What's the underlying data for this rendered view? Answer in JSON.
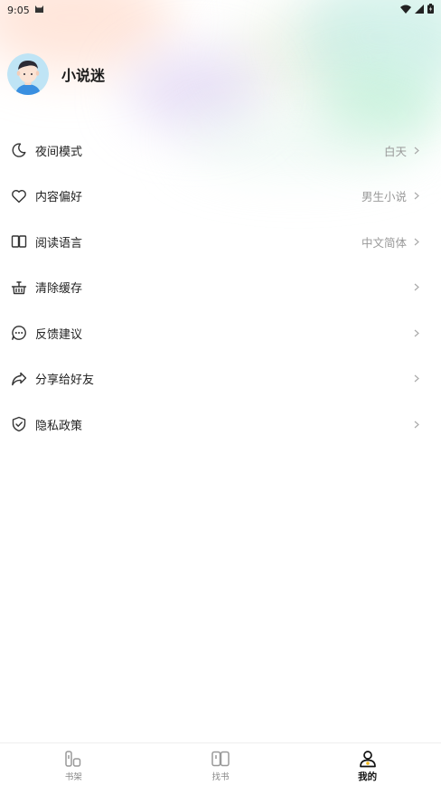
{
  "status_bar": {
    "time": "9:05"
  },
  "profile": {
    "username": "小说迷"
  },
  "menu": {
    "items": [
      {
        "label": "夜间模式",
        "value": "白天",
        "icon": "moon-icon"
      },
      {
        "label": "内容偏好",
        "value": "男生小说",
        "icon": "heart-icon"
      },
      {
        "label": "阅读语言",
        "value": "中文简体",
        "icon": "book-open-icon"
      },
      {
        "label": "清除缓存",
        "value": "",
        "icon": "basket-icon"
      },
      {
        "label": "反馈建议",
        "value": "",
        "icon": "chat-bubble-icon"
      },
      {
        "label": "分享给好友",
        "value": "",
        "icon": "share-icon"
      },
      {
        "label": "隐私政策",
        "value": "",
        "icon": "shield-icon"
      }
    ]
  },
  "tabs": [
    {
      "label": "书架",
      "icon": "bookshelf-icon",
      "active": false
    },
    {
      "label": "找书",
      "icon": "find-book-icon",
      "active": false
    },
    {
      "label": "我的",
      "icon": "profile-icon",
      "active": true
    }
  ],
  "colors": {
    "accent": "#1a1a1a",
    "muted": "#999999",
    "avatar_bg": "#bfe4f5",
    "avatar_shirt": "#3a8fe0"
  }
}
